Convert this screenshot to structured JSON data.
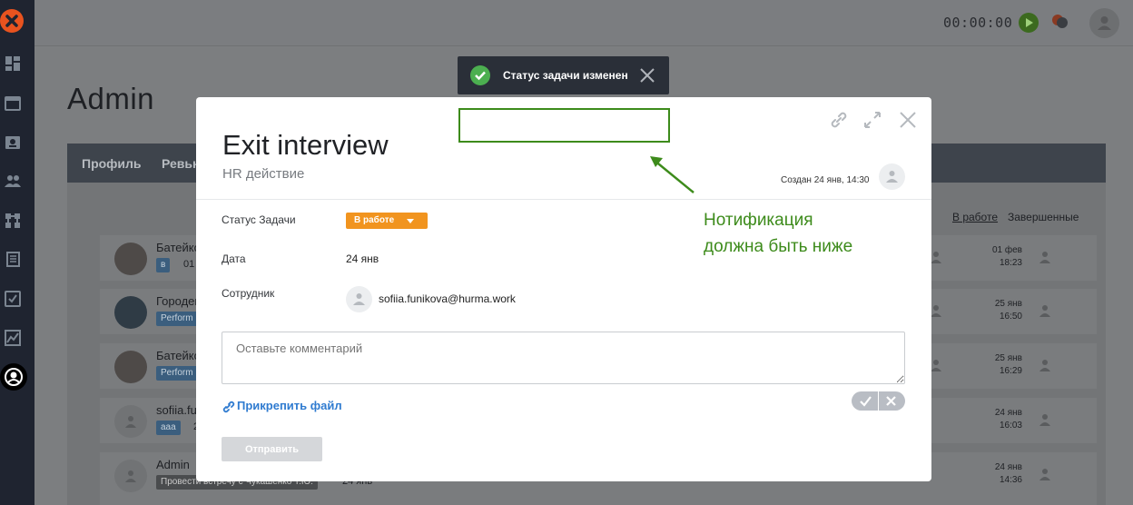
{
  "timer": "00:00:00",
  "page": {
    "title": "Admin",
    "tabs": [
      "Профиль",
      "Ревью"
    ],
    "filters": [
      "В работе",
      "Завершенные"
    ]
  },
  "rows": [
    {
      "name": "Батейко",
      "tag": "в",
      "extra": "01",
      "date": "01 фев",
      "time": "18:23",
      "avatar": "photo"
    },
    {
      "name": "Городен",
      "tag": "Perform",
      "date": "25 янв",
      "time": "16:50",
      "avatar": "photo"
    },
    {
      "name": "Батейко",
      "tag": "Perform",
      "date": "25 янв",
      "time": "16:29",
      "avatar": "photo"
    },
    {
      "name": "sofiia.fu",
      "tag": "ааа",
      "extra": "2",
      "date": "24 янв",
      "time": "16:03",
      "avatar": "blank"
    },
    {
      "name": "Admin",
      "tag": "Провести встречу с Чукашенко Т.Ю.",
      "extra": "24 янв",
      "date": "24 янв",
      "time": "14:36",
      "avatar": "blank"
    }
  ],
  "toast": {
    "message": "Статус задачи изменен",
    "icon": "check-circle-icon",
    "color": "#4caf50"
  },
  "modal": {
    "title": "Exit interview",
    "subtitle": "HR действие",
    "created": "Создан 24 янв, 14:30",
    "fields": {
      "status_label": "Статус Задачи",
      "status_value": "В работе",
      "date_label": "Дата",
      "date_value": "24 янв",
      "employee_label": "Сотрудник",
      "employee_value": "sofiia.funikova@hurma.work"
    },
    "comment_placeholder": "Оставьте комментарий",
    "attach_label": "Прикрепить файл",
    "send_label": "Отправить",
    "status_color": "#f1941f",
    "link_color": "#2f7bd0"
  },
  "annotation": {
    "text_line1": "Нотификация",
    "text_line2": "должна быть ниже",
    "color": "#3d8b1b"
  }
}
